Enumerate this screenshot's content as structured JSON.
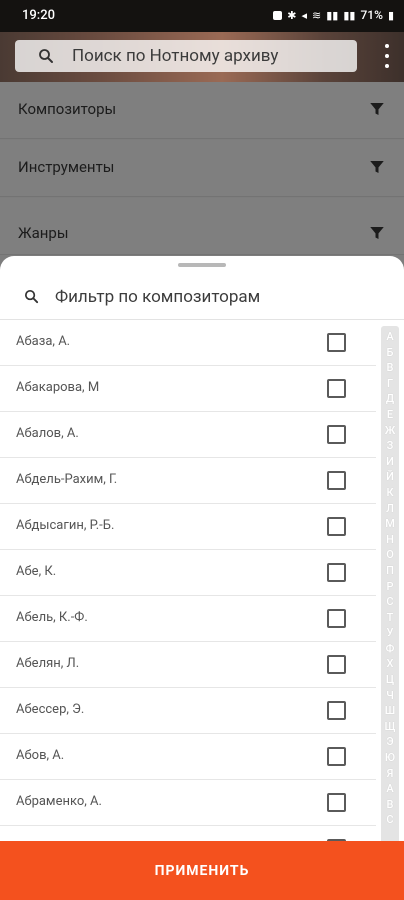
{
  "status_bar": {
    "time": "19:20",
    "battery": "71%"
  },
  "header": {
    "search_placeholder": "Поиск по Нотному архиву"
  },
  "filters": [
    {
      "label": "Композиторы"
    },
    {
      "label": "Инструменты"
    },
    {
      "label": "Жанры"
    }
  ],
  "sheet": {
    "search_placeholder": "Фильтр по композиторам",
    "items": [
      {
        "label": "Абаза, А.",
        "checked": false
      },
      {
        "label": "Абакарова, М",
        "checked": false
      },
      {
        "label": "Абалов, А.",
        "checked": false
      },
      {
        "label": "Абдель-Рахим, Г.",
        "checked": false
      },
      {
        "label": "Абдысагин, Р.-Б.",
        "checked": false
      },
      {
        "label": "Абе, К.",
        "checked": false
      },
      {
        "label": "Абель, К.-Ф.",
        "checked": false
      },
      {
        "label": "Абелян, Л.",
        "checked": false
      },
      {
        "label": "Абессер, Э.",
        "checked": false
      },
      {
        "label": "Абов, А.",
        "checked": false
      },
      {
        "label": "Абраменко, А.",
        "checked": false
      },
      {
        "label": "",
        "checked": false
      }
    ],
    "alphabet": [
      "А",
      "Б",
      "В",
      "Г",
      "Д",
      "Е",
      "Ж",
      "З",
      "И",
      "Й",
      "К",
      "Л",
      "М",
      "Н",
      "О",
      "П",
      "Р",
      "С",
      "Т",
      "У",
      "Ф",
      "Х",
      "Ц",
      "Ч",
      "Ш",
      "Щ",
      "Э",
      "Ю",
      "Я",
      "A",
      "B",
      "C"
    ]
  },
  "apply_button": {
    "label": "ПРИМЕНИТЬ"
  },
  "colors": {
    "accent": "#f4511e"
  }
}
